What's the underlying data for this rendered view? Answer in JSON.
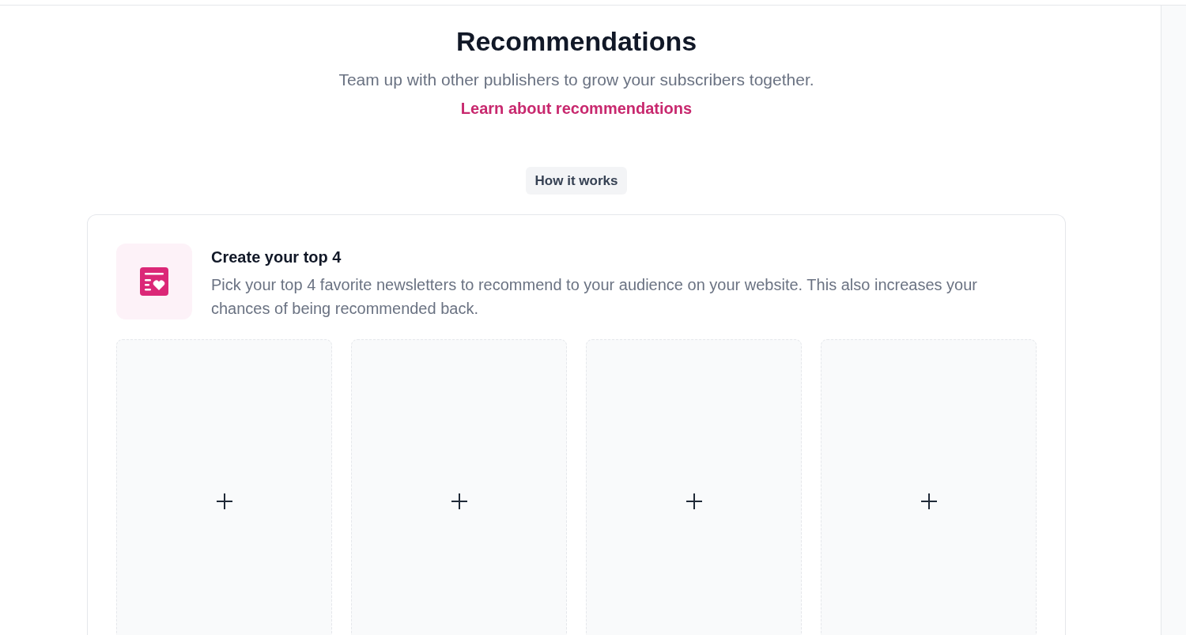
{
  "header": {
    "title": "Recommendations",
    "subtitle": "Team up with other publishers to grow your subscribers together.",
    "link": "Learn about recommendations",
    "how_it_works_button": "How it works"
  },
  "top_card": {
    "title": "Create your top 4",
    "description": "Pick your top 4 favorite newsletters to recommend to your audience on your website. This also increases your chances of being recommended back.",
    "slots": [
      {
        "filled": false
      },
      {
        "filled": false
      },
      {
        "filled": false
      },
      {
        "filled": false
      }
    ]
  }
}
